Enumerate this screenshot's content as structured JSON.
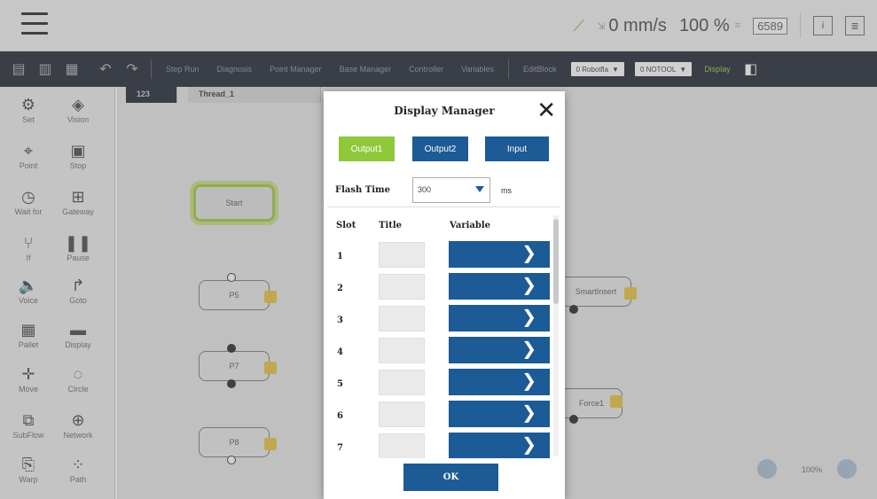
{
  "status": {
    "speed": "0 mm/s",
    "percent": "100 %",
    "counter": "6589"
  },
  "toolbar": {
    "items": [
      "Step Run",
      "Diagnosis",
      "Point Manager",
      "Base Manager",
      "Controller",
      "Variables",
      "EditBlock"
    ],
    "robot_dd": "0 Robotfla",
    "tool_dd": "0 NOTOOL",
    "display": "Display"
  },
  "palette": [
    {
      "label": "Set",
      "icon": "set-icon"
    },
    {
      "label": "Vision",
      "icon": "vision-icon"
    },
    {
      "label": "Point",
      "icon": "point-icon"
    },
    {
      "label": "Stop",
      "icon": "stop-icon"
    },
    {
      "label": "Wait for",
      "icon": "wait-icon"
    },
    {
      "label": "Gateway",
      "icon": "gateway-icon"
    },
    {
      "label": "If",
      "icon": "if-icon"
    },
    {
      "label": "Pause",
      "icon": "pause-icon"
    },
    {
      "label": "Voice",
      "icon": "voice-icon"
    },
    {
      "label": "Goto",
      "icon": "goto-icon"
    },
    {
      "label": "Pallet",
      "icon": "pallet-icon"
    },
    {
      "label": "Display",
      "icon": "display-icon"
    },
    {
      "label": "Move",
      "icon": "move-icon"
    },
    {
      "label": "Circle",
      "icon": "circle-icon"
    },
    {
      "label": "SubFlow",
      "icon": "subflow-icon"
    },
    {
      "label": "Network",
      "icon": "network-icon"
    },
    {
      "label": "Warp",
      "icon": "warp-icon"
    },
    {
      "label": "Path",
      "icon": "path-icon"
    }
  ],
  "canvas": {
    "tabs": [
      "123",
      "Thread_1"
    ],
    "start_label": "Start",
    "nodes": [
      "P5",
      "P7",
      "P8",
      "SmartInsert",
      "Force1"
    ],
    "zoom_text": "100%"
  },
  "modal": {
    "title": "Display Manager",
    "buttons": [
      "Output1",
      "Output2",
      "Input"
    ],
    "flash_label": "Flash Time",
    "flash_value": "300",
    "flash_unit": "ms",
    "headers": {
      "slot": "Slot",
      "title": "Title",
      "variable": "Variable"
    },
    "slots": [
      "1",
      "2",
      "3",
      "4",
      "5",
      "6",
      "7"
    ],
    "ok": "OK",
    "colors": {
      "active": "#8fc83a",
      "primary": "#1c5b95"
    }
  }
}
